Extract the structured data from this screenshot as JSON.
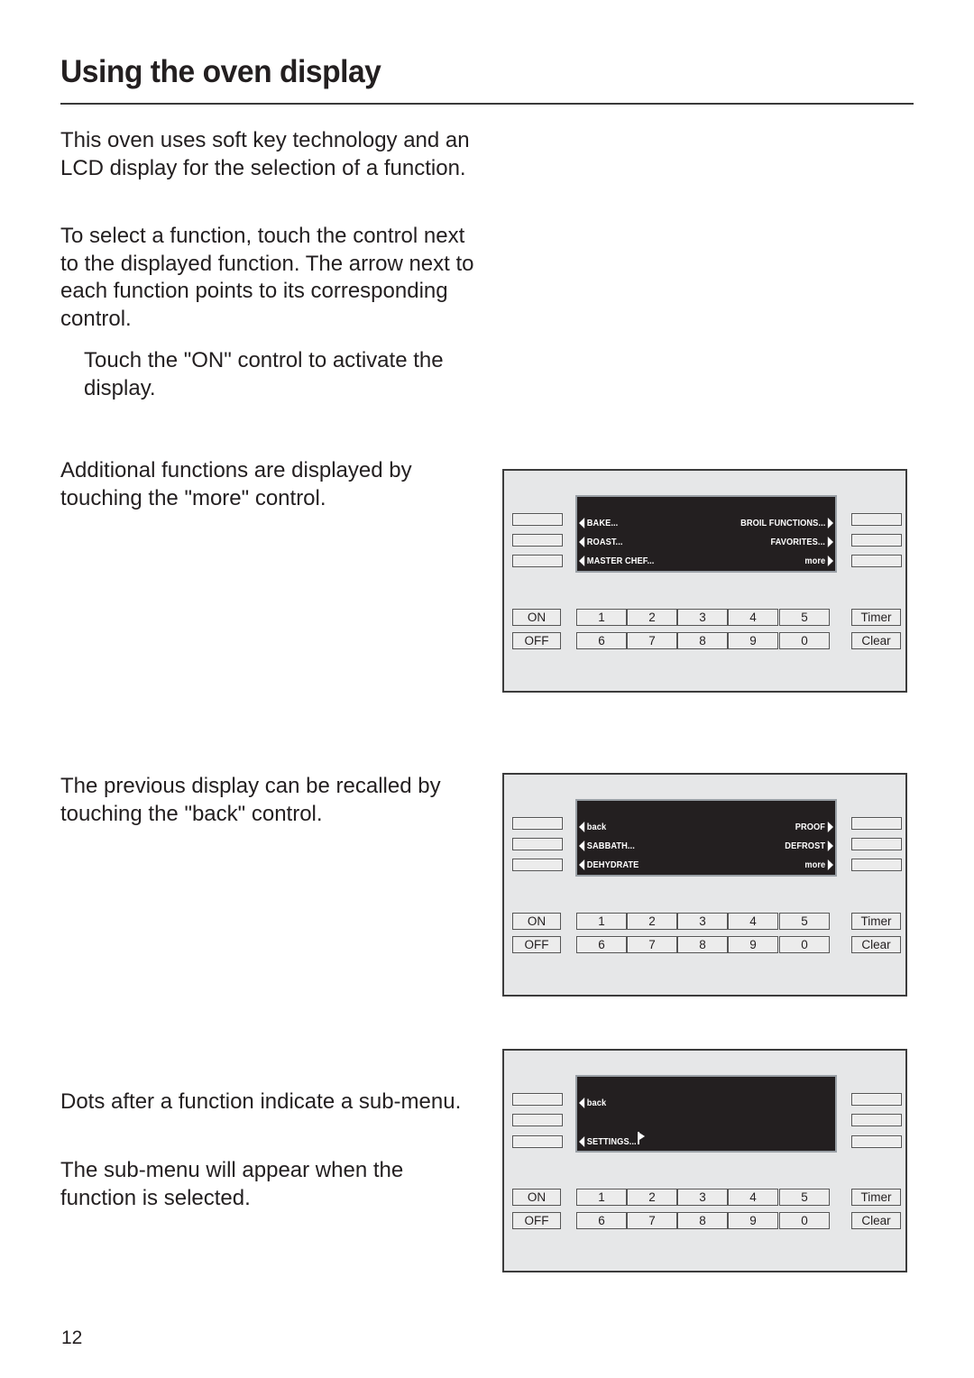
{
  "page": {
    "title": "Using the oven display",
    "page_number": "12"
  },
  "paragraphs": {
    "intro": "This oven uses soft key technology and an LCD display for the selection of a function.",
    "select": "To select a function, touch the control next to the displayed function. The arrow next to each function points to its corresponding control.",
    "activate": "Touch the \"ON\" control to activate the display.",
    "more": "Additional functions are displayed by touching the \"more\" control.",
    "back": "The previous display can be recalled by touching the \"back\" control.",
    "dots": "Dots after a function indicate a sub-menu.",
    "submenu": "The sub-menu will appear when the function is selected."
  },
  "keypad": {
    "on": "ON",
    "off": "OFF",
    "digits_row1": [
      "1",
      "2",
      "3",
      "4",
      "5"
    ],
    "digits_row2": [
      "6",
      "7",
      "8",
      "9",
      "0"
    ],
    "timer": "Timer",
    "clear": "Clear"
  },
  "displays": [
    {
      "left": [
        "BAKE...",
        "ROAST...",
        "MASTER CHEF..."
      ],
      "right": [
        "BROIL FUNCTIONS...",
        "FAVORITES...",
        "more"
      ]
    },
    {
      "left": [
        "back",
        "SABBATH...",
        "DEHYDRATE"
      ],
      "right": [
        "PROOF",
        "DEFROST",
        "more"
      ]
    },
    {
      "left": [
        "back",
        "",
        "SETTINGS..."
      ],
      "right": [
        "",
        "",
        ""
      ],
      "cursor_icon": "flag-cursor-icon"
    }
  ],
  "colors": {
    "lcd_background": "#231f20",
    "lcd_text": "#ffffff",
    "panel_background": "#e6e7e8",
    "text": "#231f20"
  }
}
